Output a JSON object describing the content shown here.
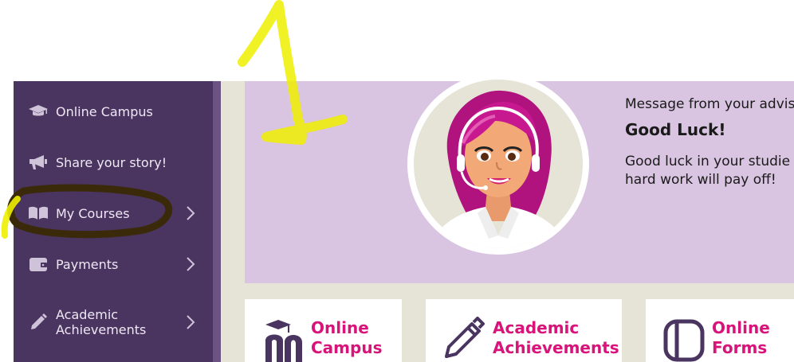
{
  "sidebar": {
    "items": [
      {
        "label": "Online Campus",
        "icon": "graduation-cap-icon",
        "has_chevron": false
      },
      {
        "label": "Share your story!",
        "icon": "megaphone-icon",
        "has_chevron": false
      },
      {
        "label": "My Courses",
        "icon": "open-book-icon",
        "has_chevron": true
      },
      {
        "label": "Payments",
        "icon": "wallet-icon",
        "has_chevron": true
      },
      {
        "label_line1": "Academic",
        "label_line2": "Achievements",
        "icon": "pencil-icon",
        "has_chevron": true
      }
    ]
  },
  "message": {
    "header": "Message from your advis",
    "title": "Good Luck!",
    "body_line1": "Good luck in your studie",
    "body_line2": "hard work will pay off!"
  },
  "cards": [
    {
      "line1": "Online",
      "line2": "Campus",
      "icon": "moodle-logo-icon"
    },
    {
      "line1": "Academic",
      "line2": "Achievements",
      "icon": "pencil-outline-icon"
    },
    {
      "line1": "Online",
      "line2": "Forms",
      "icon": "forms-icon"
    }
  ],
  "colors": {
    "sidebar": "#4a3460",
    "hero": "#d9c4e1",
    "main_background": "#e5e4d6",
    "accent": "#d8137a",
    "annotation_yellow": "#eef000",
    "annotation_circle": "#3a2a0a"
  }
}
